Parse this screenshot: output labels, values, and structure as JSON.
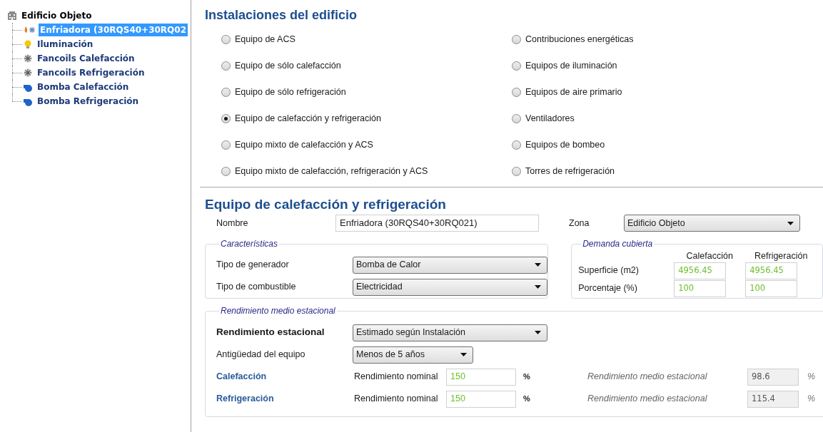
{
  "tree": {
    "label": "Edificio Objeto",
    "children": [
      {
        "label": "Enfriadora (30RQS40+30RQ02",
        "kind": "chiller",
        "selected": true
      },
      {
        "label": "Iluminación",
        "kind": "light",
        "selected": false
      },
      {
        "label": "Fancoils Calefacción",
        "kind": "fan",
        "selected": false
      },
      {
        "label": "Fancoils Refrigeración",
        "kind": "fan",
        "selected": false
      },
      {
        "label": "Bomba Calefacción",
        "kind": "pump",
        "selected": false
      },
      {
        "label": "Bomba Refrigeración",
        "kind": "pump",
        "selected": false
      }
    ]
  },
  "installations": {
    "title": "Instalaciones del edificio",
    "options": [
      {
        "label": "Equipo de ACS",
        "selected": false
      },
      {
        "label": "Contribuciones energéticas",
        "selected": false
      },
      {
        "label": "Equipo de sólo calefacción",
        "selected": false
      },
      {
        "label": "Equipos de iluminación",
        "selected": false
      },
      {
        "label": "Equipo de sólo refrigeración",
        "selected": false
      },
      {
        "label": "Equipos de aire primario",
        "selected": false
      },
      {
        "label": "Equipo de calefacción y refrigeración",
        "selected": true
      },
      {
        "label": "Ventiladores",
        "selected": false
      },
      {
        "label": "Equipo mixto de calefacción y ACS",
        "selected": false
      },
      {
        "label": "Equipos de bombeo",
        "selected": false
      },
      {
        "label": "Equipo mixto de calefacción, refrigeración y ACS",
        "selected": false
      },
      {
        "label": "Torres de refrigeración",
        "selected": false
      }
    ]
  },
  "equipment": {
    "title": "Equipo de calefacción y refrigeración",
    "name": {
      "label": "Nombre",
      "value": "Enfriadora (30RQS40+30RQ021)"
    },
    "zone": {
      "label": "Zona",
      "value": "Edificio Objeto"
    },
    "characteristics": {
      "legend": "Características",
      "fields": [
        {
          "label": "Tipo de generador",
          "value": "Bomba de Calor"
        },
        {
          "label": "Tipo de combustible",
          "value": "Electricidad"
        }
      ]
    },
    "demand": {
      "legend": "Demanda cubierta",
      "columns": [
        "Calefacción",
        "Refrigeración"
      ],
      "rows": [
        {
          "label": "Superficie (m2)",
          "values": [
            "4956.45",
            "4956.45"
          ]
        },
        {
          "label": "Porcentaje (%)",
          "values": [
            "100",
            "100"
          ]
        }
      ]
    },
    "performance": {
      "legend": "Rendimiento medio estacional",
      "method": {
        "label": "Rendimiento estacional",
        "value": "Estimado según Instalación"
      },
      "age": {
        "label": "Antigüedad del equipo",
        "value": "Menos de 5 años"
      },
      "rows": [
        {
          "label": "Calefacción",
          "nominal_label": "Rendimiento nominal",
          "nominal": "150",
          "unit": "%",
          "seasonal_label": "Rendimiento medio estacional",
          "seasonal": "98.6",
          "seasonal_unit": "%"
        },
        {
          "label": "Refrigeración",
          "nominal_label": "Rendimiento nominal",
          "nominal": "150",
          "unit": "%",
          "seasonal_label": "Rendimiento medio estacional",
          "seasonal": "115.4",
          "seasonal_unit": "%"
        }
      ]
    }
  }
}
